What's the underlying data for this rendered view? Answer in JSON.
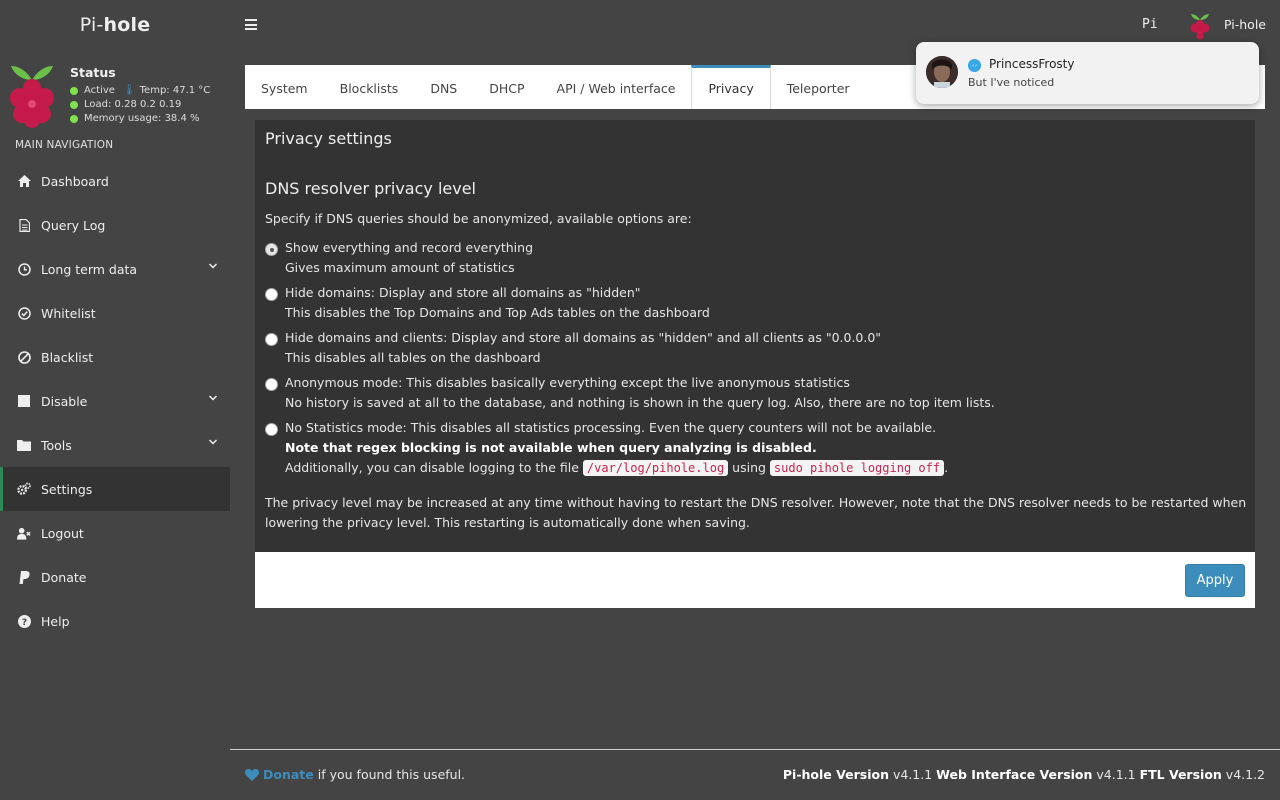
{
  "brand": {
    "pre": "Pi-",
    "bold": "hole"
  },
  "status": {
    "title": "Status",
    "active": "Active",
    "temp": "Temp: 47.1 °C",
    "load": "Load:  0.28  0.2  0.19",
    "memory": "Memory usage:  38.4 %"
  },
  "nav_header": "MAIN NAVIGATION",
  "nav": [
    {
      "label": "Dashboard",
      "icon": "home-icon"
    },
    {
      "label": "Query Log",
      "icon": "file-icon"
    },
    {
      "label": "Long term data",
      "icon": "clock-icon",
      "expandable": true
    },
    {
      "label": "Whitelist",
      "icon": "check-circle-icon"
    },
    {
      "label": "Blacklist",
      "icon": "ban-icon"
    },
    {
      "label": "Disable",
      "icon": "stop-icon",
      "expandable": true
    },
    {
      "label": "Tools",
      "icon": "folder-icon",
      "expandable": true
    },
    {
      "label": "Settings",
      "icon": "gears-icon",
      "active": true
    },
    {
      "label": "Logout",
      "icon": "user-times-icon"
    },
    {
      "label": "Donate",
      "icon": "paypal-icon"
    },
    {
      "label": "Help",
      "icon": "question-icon"
    }
  ],
  "header": {
    "hostname": "Pi",
    "user": "Pi-hole"
  },
  "tabs": [
    "System",
    "Blocklists",
    "DNS",
    "DHCP",
    "API / Web interface",
    "Privacy",
    "Teleporter"
  ],
  "active_tab": "Privacy",
  "box": {
    "title": "Privacy settings",
    "section": "DNS resolver privacy level",
    "description": "Specify if DNS queries should be anonymized, available options are:",
    "options": [
      {
        "label": "Show everything and record everything",
        "detail": "Gives maximum amount of statistics",
        "checked": true
      },
      {
        "label": "Hide domains: Display and store all domains as \"hidden\"",
        "detail": "This disables the Top Domains and Top Ads tables on the dashboard"
      },
      {
        "label": "Hide domains and clients: Display and store all domains as \"hidden\" and all clients as \"0.0.0.0\"",
        "detail": "This disables all tables on the dashboard"
      },
      {
        "label": "Anonymous mode: This disables basically everything except the live anonymous statistics",
        "detail": "No history is saved at all to the database, and nothing is shown in the query log. Also, there are no top item lists."
      },
      {
        "label": "No Statistics mode: This disables all statistics processing. Even the query counters will not be available.",
        "strong": "Note that regex blocking is not available when query analyzing is disabled.",
        "extra_pre": "Additionally, you can disable logging to the file ",
        "code1": "/var/log/pihole.log",
        "extra_mid": " using ",
        "code2": "sudo pihole logging off",
        "extra_post": "."
      }
    ],
    "note": "The privacy level may be increased at any time without having to restart the DNS resolver. However, note that the DNS resolver needs to be restarted when lowering the privacy level. This restarting is automatically done when saving.",
    "apply": "Apply"
  },
  "footer": {
    "donate": "Donate",
    "donate_rest": "if you found this useful.",
    "pihole_label": "Pi-hole Version",
    "pihole_ver": "v4.1.1",
    "web_label": "Web Interface Version",
    "web_ver": "v4.1.1",
    "ftl_label": "FTL Version",
    "ftl_ver": "v4.1.2"
  },
  "notification": {
    "name": "PrincessFrosty",
    "message": "But I've noticed"
  },
  "colors": {
    "accent": "#3c8dbc",
    "active_nav": "#2d8a57",
    "status_ok": "#7fe34e",
    "raspberry": "#c51a4a",
    "leaf": "#6cc04a"
  }
}
